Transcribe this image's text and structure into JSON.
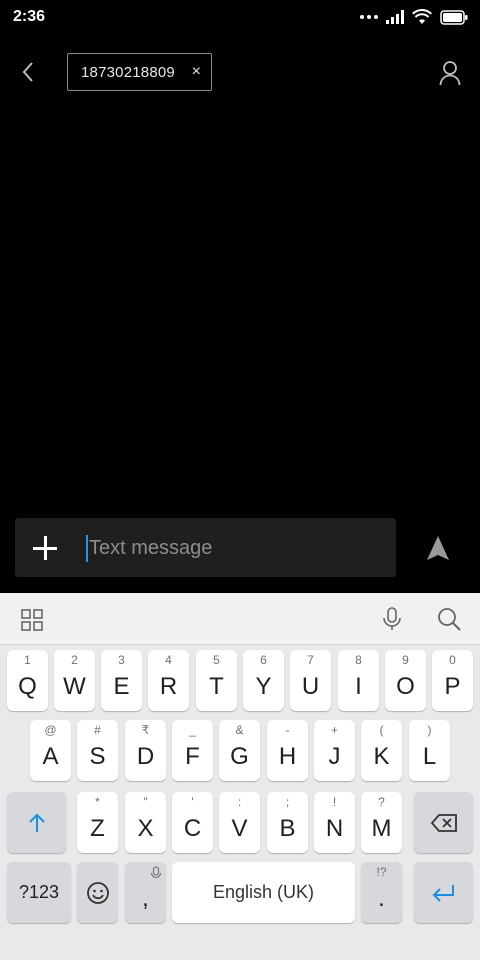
{
  "status_bar": {
    "time": "2:36"
  },
  "header": {
    "recipient": "18730218809",
    "chip_close": "×"
  },
  "compose": {
    "placeholder": "Text message"
  },
  "keyboard": {
    "row1": [
      {
        "key": "Q",
        "hint": "1"
      },
      {
        "key": "W",
        "hint": "2"
      },
      {
        "key": "E",
        "hint": "3"
      },
      {
        "key": "R",
        "hint": "4"
      },
      {
        "key": "T",
        "hint": "5"
      },
      {
        "key": "Y",
        "hint": "6"
      },
      {
        "key": "U",
        "hint": "7"
      },
      {
        "key": "I",
        "hint": "8"
      },
      {
        "key": "O",
        "hint": "9"
      },
      {
        "key": "P",
        "hint": "0"
      }
    ],
    "row2": [
      {
        "key": "A",
        "hint": "@"
      },
      {
        "key": "S",
        "hint": "#"
      },
      {
        "key": "D",
        "hint": "₹"
      },
      {
        "key": "F",
        "hint": "_"
      },
      {
        "key": "G",
        "hint": "&"
      },
      {
        "key": "H",
        "hint": "-"
      },
      {
        "key": "J",
        "hint": "+"
      },
      {
        "key": "K",
        "hint": "("
      },
      {
        "key": "L",
        "hint": ")"
      }
    ],
    "row3": [
      {
        "key": "Z",
        "hint": "*"
      },
      {
        "key": "X",
        "hint": "\""
      },
      {
        "key": "C",
        "hint": "'"
      },
      {
        "key": "V",
        "hint": ":"
      },
      {
        "key": "B",
        "hint": ";"
      },
      {
        "key": "N",
        "hint": "!"
      },
      {
        "key": "M",
        "hint": "?"
      }
    ],
    "symbols_label": "?123",
    "comma_label": ",",
    "space_label": "English (UK)",
    "period_label": ".",
    "period_hint": "!?"
  }
}
